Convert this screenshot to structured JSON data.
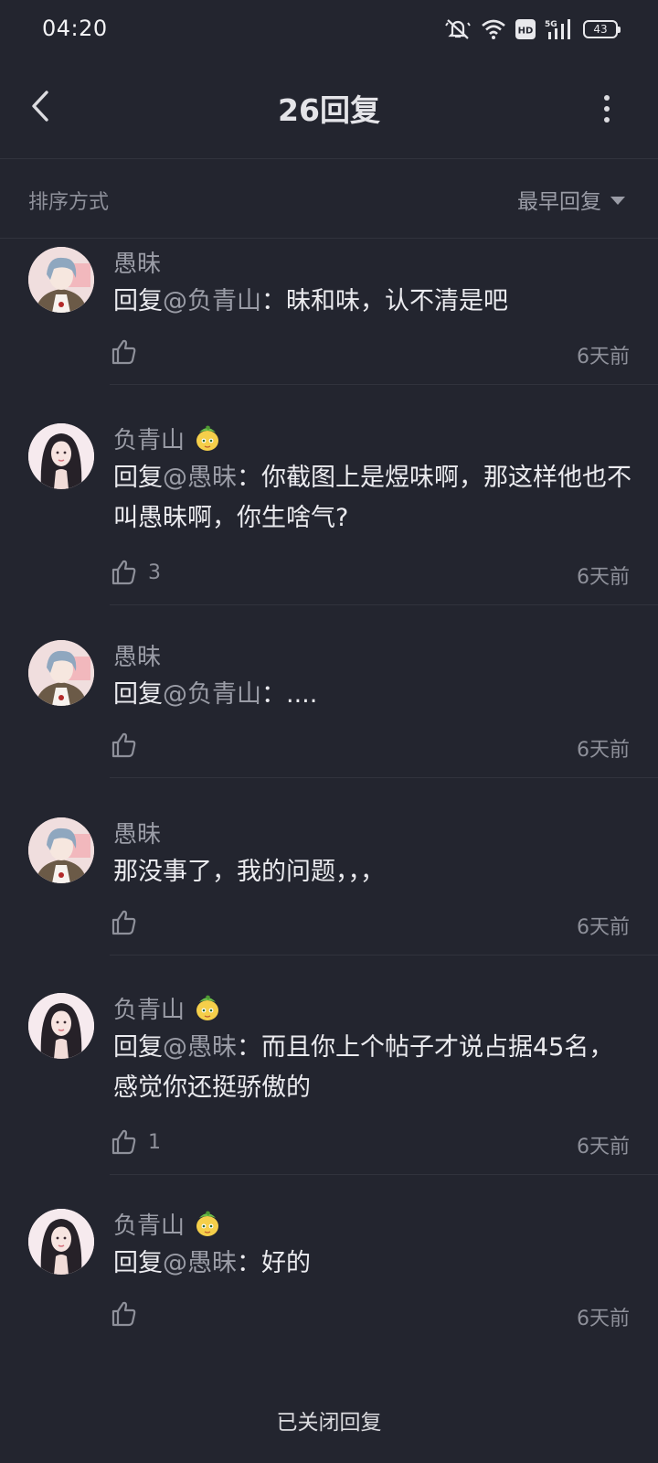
{
  "status_bar": {
    "time": "04:20",
    "battery": "43",
    "icons": [
      "mute-icon",
      "wifi-icon",
      "hd-icon",
      "5g-signal-icon",
      "battery-icon"
    ]
  },
  "header": {
    "title": "26回复",
    "back_icon": "chevron-left-icon",
    "more_icon": "more-vertical-icon"
  },
  "sort": {
    "label": "排序方式",
    "selected": "最早回复"
  },
  "comments": [
    {
      "user": "愚昧",
      "avatar": "male-avatar",
      "has_badge": false,
      "prefix": "回复",
      "mention": "@负青山",
      "separator": "：",
      "body": "昧和味，认不清是吧",
      "likes": "",
      "time": "6天前"
    },
    {
      "user": "负青山",
      "avatar": "female-avatar",
      "has_badge": true,
      "prefix": "回复",
      "mention": "@愚昧",
      "separator": "：",
      "body": "你截图上是煜味啊，那这样他也不叫愚昧啊，你生啥气?",
      "likes": "3",
      "time": "6天前"
    },
    {
      "user": "愚昧",
      "avatar": "male-avatar",
      "has_badge": false,
      "prefix": "回复",
      "mention": "@负青山",
      "separator": "：",
      "body": "....",
      "likes": "",
      "time": "6天前"
    },
    {
      "user": "愚昧",
      "avatar": "male-avatar",
      "has_badge": false,
      "prefix": "",
      "mention": "",
      "separator": "",
      "body": "那没事了，我的问题，，，",
      "likes": "",
      "time": "6天前"
    },
    {
      "user": "负青山",
      "avatar": "female-avatar",
      "has_badge": true,
      "prefix": "回复",
      "mention": "@愚昧",
      "separator": "：",
      "body": "而且你上个帖子才说占据45名，感觉你还挺骄傲的",
      "likes": "1",
      "time": "6天前"
    },
    {
      "user": "负青山",
      "avatar": "female-avatar",
      "has_badge": true,
      "prefix": "回复",
      "mention": "@愚昧",
      "separator": "：",
      "body": "好的",
      "likes": "",
      "time": "6天前"
    }
  ],
  "footer": {
    "note": "已关闭回复"
  }
}
